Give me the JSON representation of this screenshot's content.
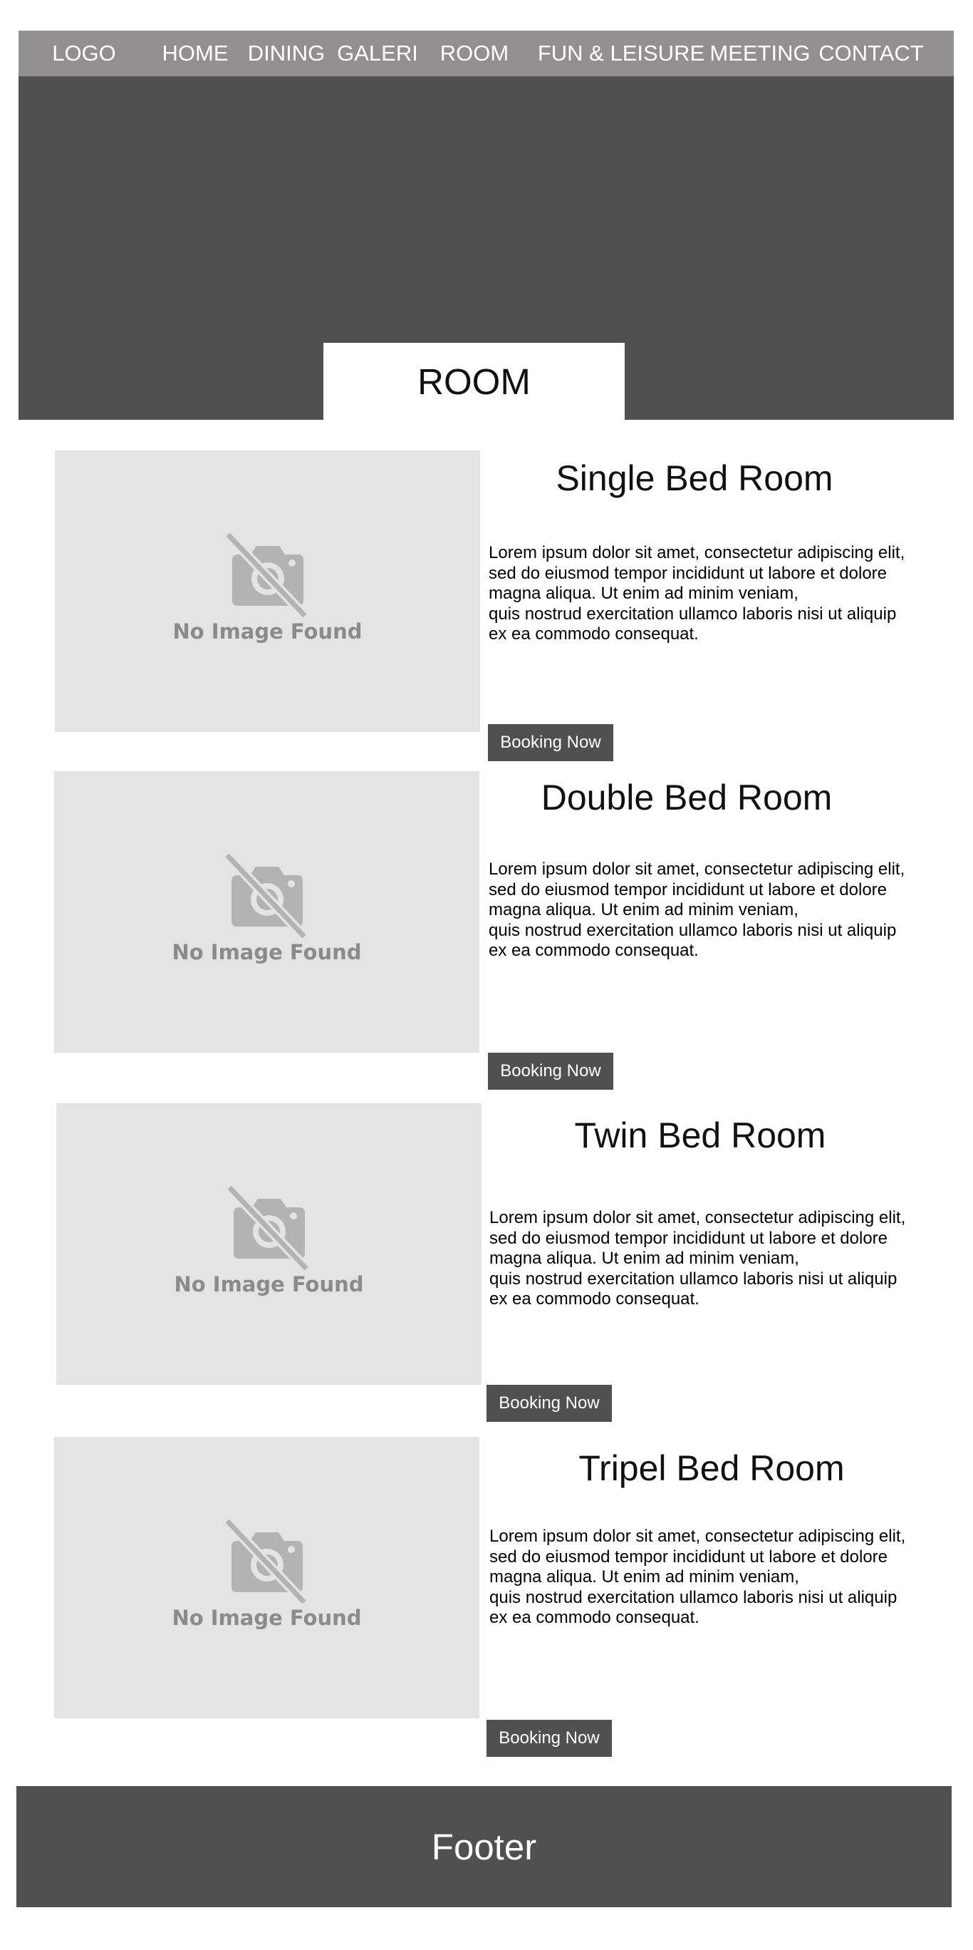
{
  "nav": {
    "logo": "LOGO",
    "items": [
      {
        "label": "HOME"
      },
      {
        "label": "DINING"
      },
      {
        "label": "GALERI"
      },
      {
        "label": "ROOM"
      },
      {
        "label": "FUN & LEISURE"
      },
      {
        "label": "MEETING"
      },
      {
        "label": "CONTACT"
      }
    ]
  },
  "hero": {
    "title": "ROOM"
  },
  "rooms": [
    {
      "title": "Single Bed Room",
      "image_placeholder": "No Image Found",
      "description": "Lorem ipsum dolor sit amet, consectetur adipiscing elit,\nsed do eiusmod tempor incididunt ut labore et dolore\nmagna aliqua. Ut enim ad minim veniam,\nquis nostrud exercitation ullamco laboris nisi ut aliquip\nex ea commodo consequat.",
      "button": "Booking Now"
    },
    {
      "title": "Double Bed Room",
      "image_placeholder": "No Image Found",
      "description": "Lorem ipsum dolor sit amet, consectetur adipiscing elit,\nsed do eiusmod tempor incididunt ut labore et dolore\nmagna aliqua. Ut enim ad minim veniam,\nquis nostrud exercitation ullamco laboris nisi ut aliquip\nex ea commodo consequat.",
      "button": "Booking Now"
    },
    {
      "title": "Twin Bed Room",
      "image_placeholder": "No Image Found",
      "description": "Lorem ipsum dolor sit amet, consectetur adipiscing elit,\nsed do eiusmod tempor incididunt ut labore et dolore\nmagna aliqua. Ut enim ad minim veniam,\nquis nostrud exercitation ullamco laboris nisi ut aliquip\nex ea commodo consequat.",
      "button": "Booking Now"
    },
    {
      "title": "Tripel Bed Room",
      "image_placeholder": "No Image Found",
      "description": "Lorem ipsum dolor sit amet, consectetur adipiscing elit,\nsed do eiusmod tempor incididunt ut labore et dolore\nmagna aliqua. Ut enim ad minim veniam,\nquis nostrud exercitation ullamco laboris nisi ut aliquip\nex ea commodo consequat.",
      "button": "Booking Now"
    }
  ],
  "footer": {
    "text": "Footer"
  },
  "colors": {
    "nav_bg": "#918f8f",
    "hero_bg": "#505050",
    "placeholder_bg": "#e4e4e4",
    "button_bg": "#505050",
    "footer_bg": "#505050"
  },
  "icons": {
    "image_placeholder": "camera-off-icon"
  }
}
